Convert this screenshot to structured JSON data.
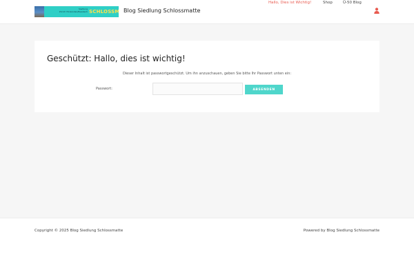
{
  "header": {
    "logo": {
      "line1": "Siedlung",
      "line2": "Zürich Hirslanden/Riesbach",
      "brand": "SCHLOSSMATTE"
    },
    "site_title": "Blog Siedlung Schlossmatte",
    "nav": {
      "items": [
        {
          "label": "Hallo, Dies ist Wichtig!",
          "active": true
        },
        {
          "label": "Shop",
          "active": false
        },
        {
          "label": "Ü-50 Blog",
          "active": false
        }
      ],
      "user_icon": "user-icon"
    }
  },
  "main": {
    "title": "Geschützt: Hallo, dies ist wichtig!",
    "notice": "Dieser Inhalt ist passwortgeschützt. Um ihn anzuschauen, geben Sie bitte Ihr Passwort unten ein:",
    "password_label": "Passwort:",
    "password_value": "",
    "submit_label": "ABSENDEN"
  },
  "footer": {
    "copyright": "Copyright © 2025 Blog Siedlung Schlossmatte",
    "powered_by": "Powered by Blog Siedlung Schlossmatte"
  },
  "colors": {
    "accent": "#e85a4f",
    "button": "#4fd6cb",
    "logo_bg": "#2fcfc6",
    "logo_text": "#ffe24a"
  }
}
